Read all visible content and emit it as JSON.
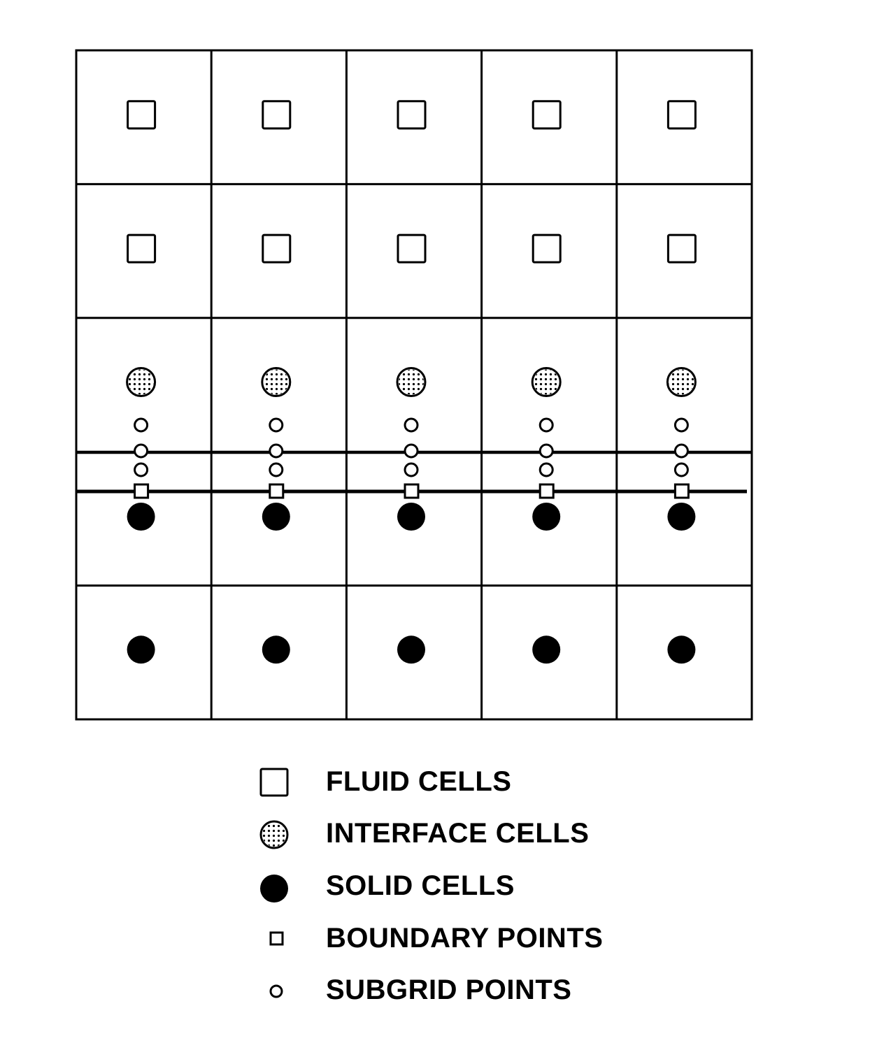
{
  "diagram": {
    "title": "",
    "grid": {
      "columns": 5,
      "rows": [
        {
          "row": 1,
          "cell_type": "fluid"
        },
        {
          "row": 2,
          "cell_type": "fluid"
        },
        {
          "row": 3,
          "cell_type": "interface"
        },
        {
          "row": 4,
          "cell_type": "solid"
        },
        {
          "row": 5,
          "cell_type": "solid"
        }
      ],
      "subgrid_points_per_column": 3,
      "boundary_points_per_column": 1
    },
    "colors": {
      "line": "#000000",
      "background": "#ffffff",
      "solid_fill": "#000000",
      "interface_fill": "#ffffff",
      "interface_dots": "#000000"
    }
  },
  "legend": {
    "items": [
      {
        "icon": "fluid-cell-square-icon",
        "label": "FLUID CELLS"
      },
      {
        "icon": "interface-cell-dotted-circle-icon",
        "label": "INTERFACE CELLS"
      },
      {
        "icon": "solid-cell-filled-circle-icon",
        "label": "SOLID CELLS"
      },
      {
        "icon": "boundary-point-small-square-icon",
        "label": "BOUNDARY POINTS"
      },
      {
        "icon": "subgrid-point-small-circle-icon",
        "label": "SUBGRID POINTS"
      }
    ]
  }
}
